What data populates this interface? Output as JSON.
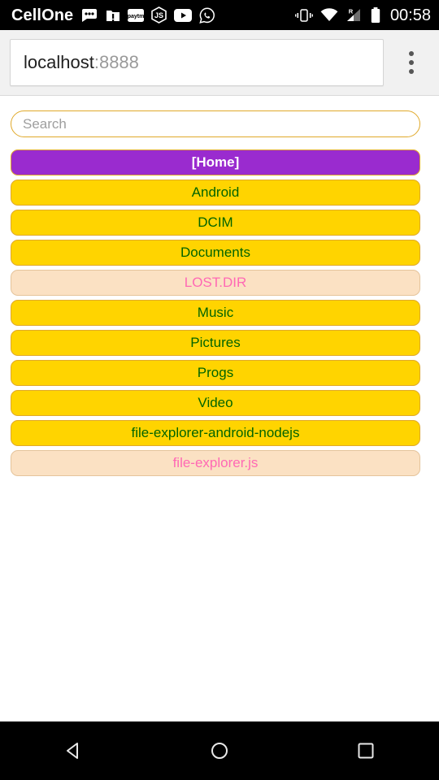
{
  "status_bar": {
    "carrier": "CellOne",
    "clock": "00:58",
    "left_icons": [
      {
        "name": "messages-icon"
      },
      {
        "name": "alert-folder-icon"
      },
      {
        "name": "paytm-icon",
        "label": "paytm"
      },
      {
        "name": "nodejs-icon",
        "label": "JS"
      },
      {
        "name": "youtube-icon"
      },
      {
        "name": "whatsapp-icon"
      }
    ],
    "right_icons": [
      {
        "name": "vibrate-icon"
      },
      {
        "name": "wifi-icon"
      },
      {
        "name": "cellular-signal-icon",
        "roaming_label": "R"
      },
      {
        "name": "battery-icon"
      }
    ]
  },
  "browser": {
    "url_host": "localhost",
    "url_port": ":8888",
    "overflow_menu_label": "More options"
  },
  "page": {
    "search": {
      "value": "",
      "placeholder": "Search"
    },
    "entries": [
      {
        "label": "[Home]",
        "kind": "home"
      },
      {
        "label": "Android",
        "kind": "dir"
      },
      {
        "label": "DCIM",
        "kind": "dir"
      },
      {
        "label": "Documents",
        "kind": "dir"
      },
      {
        "label": "LOST.DIR",
        "kind": "file"
      },
      {
        "label": "Music",
        "kind": "dir"
      },
      {
        "label": "Pictures",
        "kind": "dir"
      },
      {
        "label": "Progs",
        "kind": "dir"
      },
      {
        "label": "Video",
        "kind": "dir"
      },
      {
        "label": "file-explorer-android-nodejs",
        "kind": "dir"
      },
      {
        "label": "file-explorer.js",
        "kind": "file"
      }
    ]
  },
  "nav_bar": {
    "buttons": [
      {
        "name": "back-button"
      },
      {
        "name": "home-button"
      },
      {
        "name": "recents-button"
      }
    ]
  },
  "colors": {
    "home_purple": "#9a2bcf",
    "dir_gold": "#ffd400",
    "dir_border": "#e0a92a",
    "dir_text_green": "#006400",
    "file_peach": "#fbe1c3",
    "file_text_pink": "#ff69b4",
    "chrome_gray": "#f1f1f1"
  }
}
